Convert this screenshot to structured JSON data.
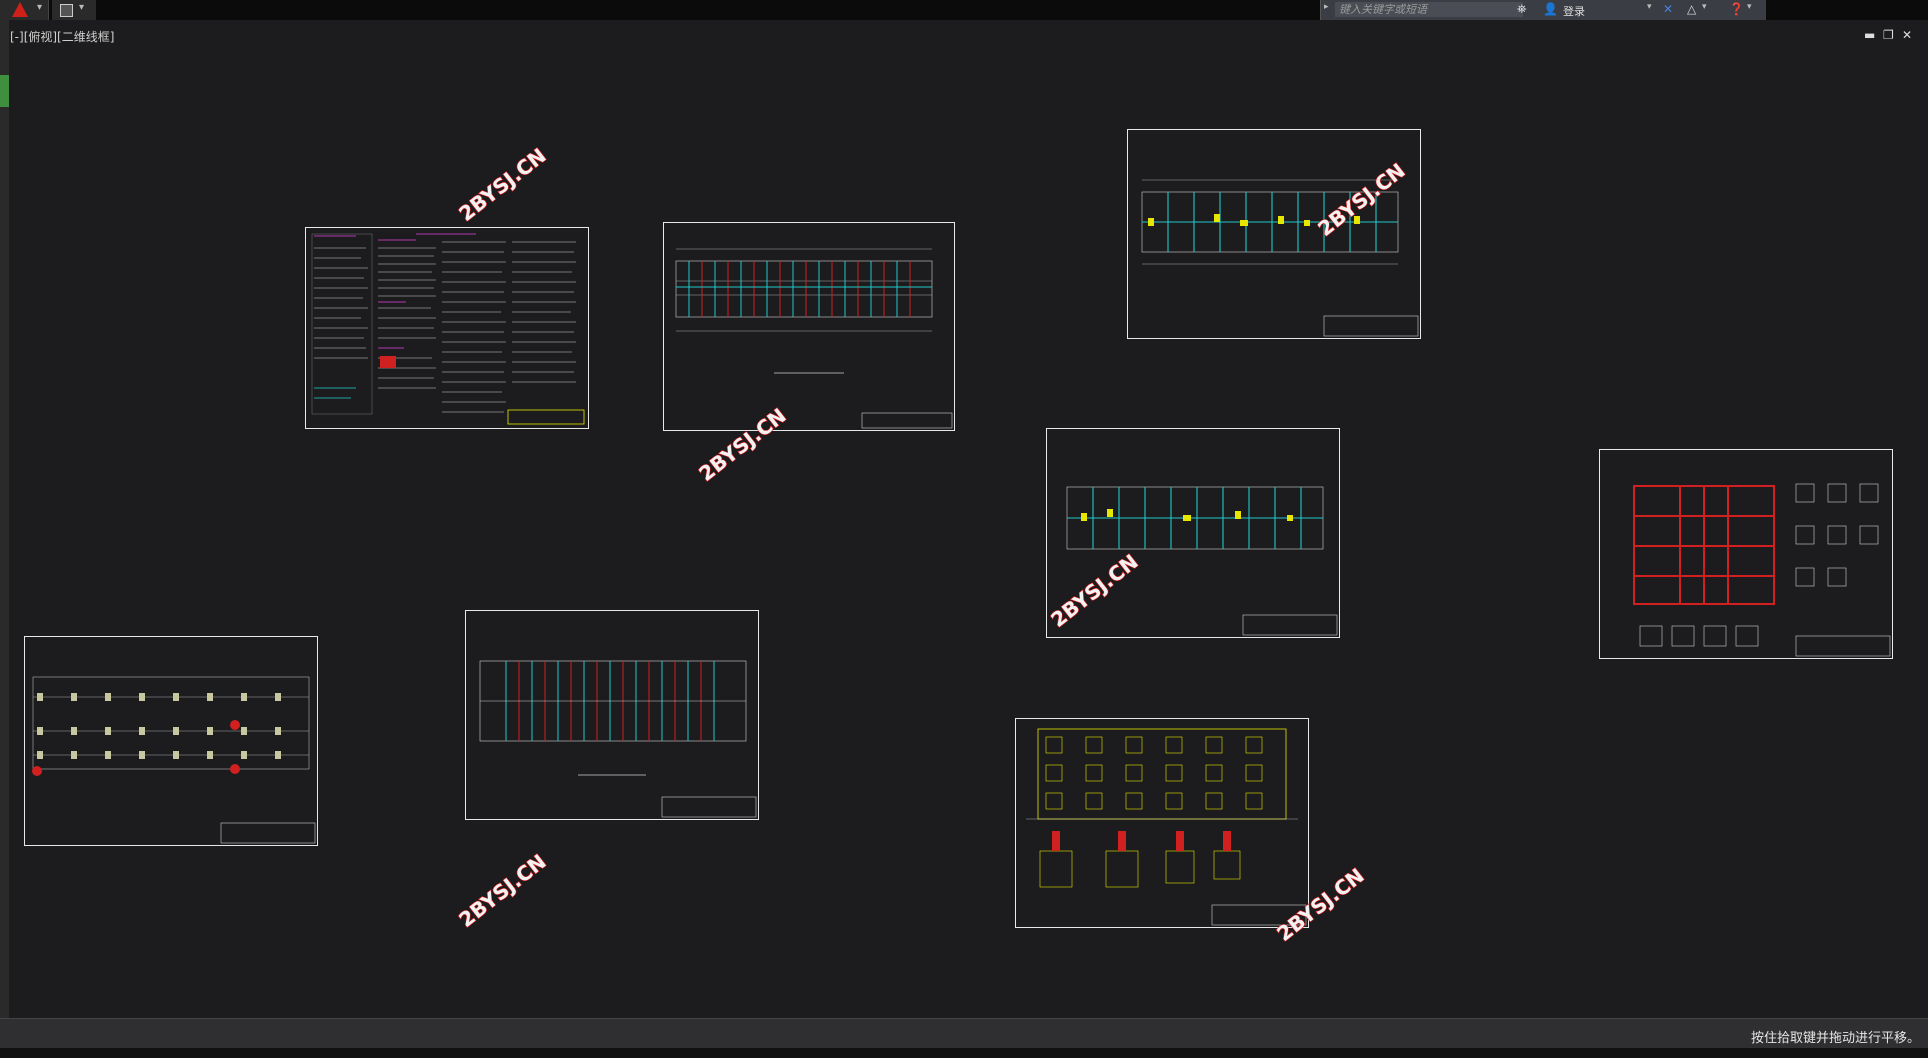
{
  "toolbar": {
    "search_placeholder": "键入关键字或短语",
    "login_label": "登录"
  },
  "viewport": {
    "label": "[-][俯视][二维线框]"
  },
  "icons": {
    "app_menu": "autocad-logo-icon",
    "save": "save-icon",
    "binoculars": "binoculars-icon",
    "user": "user-icon",
    "exchange": "x-exchange-icon",
    "a360": "a360-icon",
    "help": "help-icon"
  },
  "status": {
    "message": "按住拾取键并拖动进行平移。"
  },
  "watermark": {
    "text": "2BYSJ.CN",
    "color": "#e01818"
  }
}
